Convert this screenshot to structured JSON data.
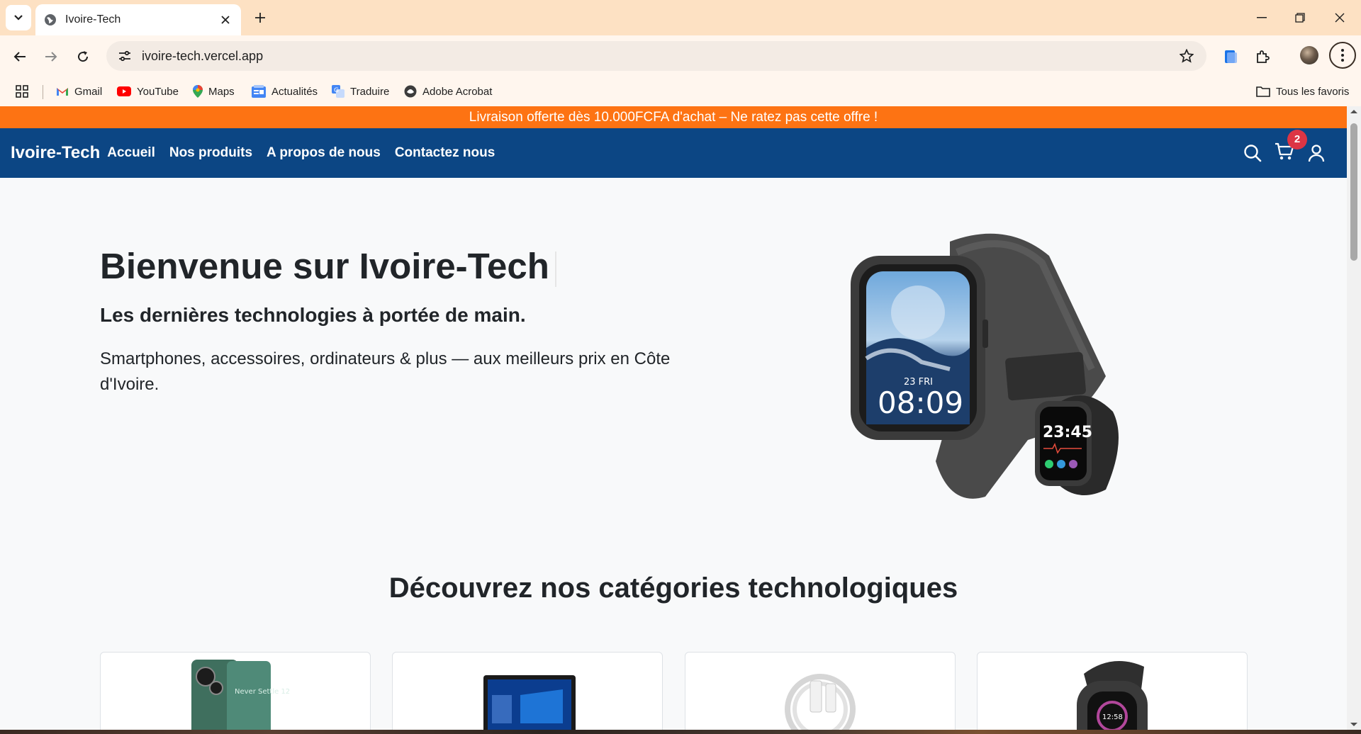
{
  "browser": {
    "tab_title": "Ivoire-Tech",
    "url": "ivoire-tech.vercel.app",
    "bookmarks": [
      {
        "label": "Gmail",
        "icon": "gmail-icon"
      },
      {
        "label": "YouTube",
        "icon": "youtube-icon"
      },
      {
        "label": "Maps",
        "icon": "maps-icon"
      },
      {
        "label": "Actualités",
        "icon": "news-icon"
      },
      {
        "label": "Traduire",
        "icon": "translate-icon"
      },
      {
        "label": "Adobe Acrobat",
        "icon": "acrobat-icon"
      }
    ],
    "all_bookmarks_label": "Tous les favoris"
  },
  "promo": {
    "text": "Livraison offerte dès 10.000FCFA d'achat – Ne ratez pas cette offre !"
  },
  "nav": {
    "brand": "Ivoire-Tech",
    "links": [
      "Accueil",
      "Nos produits",
      "A propos de nous",
      "Contactez nous"
    ],
    "cart_count": "2",
    "icons": [
      "search-icon",
      "cart-icon",
      "user-icon"
    ]
  },
  "hero": {
    "title": "Bienvenue sur Ivoire-Tech",
    "subtitle": "Les dernières technologies à portée de main.",
    "description": "Smartphones, accessoires, ordinateurs & plus — aux meilleurs prix en Côte d'Ivoire.",
    "watch_big_time": "08:09",
    "watch_big_date": "23 FRI",
    "watch_small_time": "23:45"
  },
  "categories": {
    "title": "Découvrez nos catégories technologiques",
    "items": [
      {
        "image": "smartphone",
        "screen_text": "Never Settle 12"
      },
      {
        "image": "laptop"
      },
      {
        "image": "usb-cable"
      },
      {
        "image": "smartwatch",
        "screen_text": "12:58"
      }
    ]
  },
  "colors": {
    "promo": "#fd7313",
    "nav": "#0c4684",
    "badge": "#dc3545",
    "tabstrip": "#fde1c3"
  }
}
